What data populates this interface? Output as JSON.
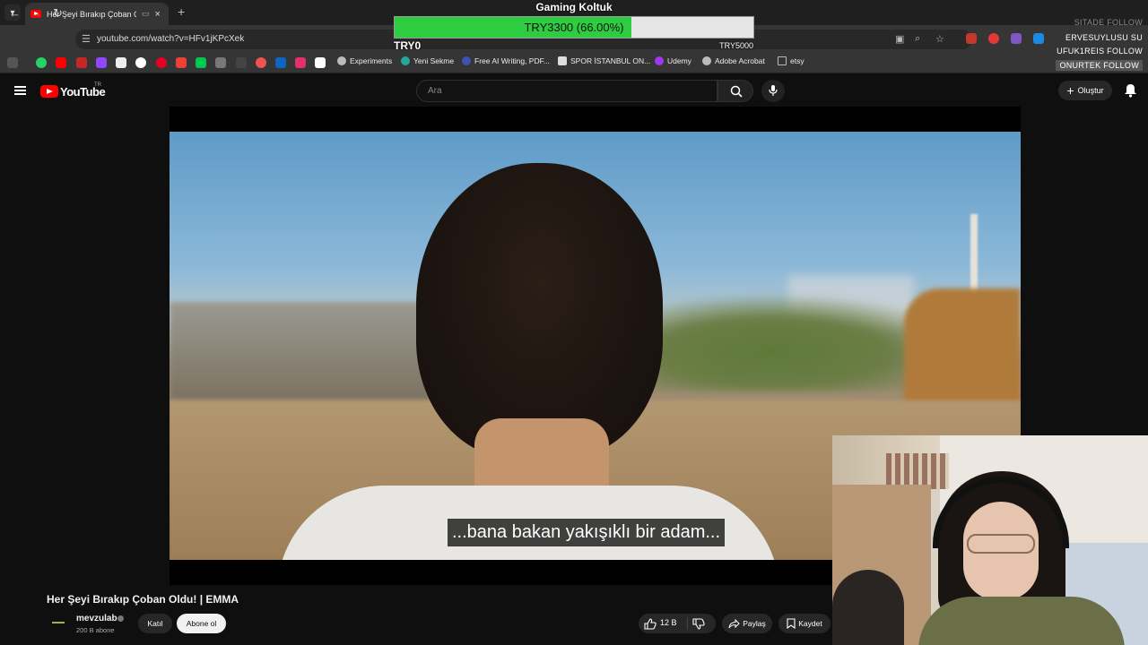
{
  "browser": {
    "tab_title": "Her Şeyi Bırakıp Çoban Oldu!",
    "url": "youtube.com/watch?v=HFv1jKPcXek",
    "bookmarks": [
      "Experiments",
      "Yeni Sekme",
      "Free AI Writing, PDF...",
      "SPOR İSTANBUL ON...",
      "Udemy",
      "Adobe Acrobat",
      "etsy"
    ]
  },
  "overlay": {
    "goal_title": "Gaming Koltuk",
    "goal_text": "TRY3300 (66.00%)",
    "goal_progress": 0.66,
    "goal_min": "TRY0",
    "goal_max": "TRY5000",
    "follows": [
      "SITADE  FOLLOW",
      "ERVESUYLUSU  SU",
      "UFUK1REIS  FOLLOW",
      "ONURTEK  FOLLOW"
    ]
  },
  "youtube": {
    "region": "TR",
    "search_placeholder": "Ara",
    "create_label": "Oluştur",
    "subtitle": "...bana bakan yakışıklı bir adam...",
    "video_title": "Her Şeyi Bırakıp Çoban Oldu! | EMMA",
    "channel_name": "mevzulab",
    "subscribers": "200 B abone",
    "join_label": "Katıl",
    "subscribe_label": "Abone ol",
    "like_count": "12 B",
    "share_label": "Paylaş",
    "save_label": "Kaydet"
  },
  "colors": {
    "brand": "#ff0000",
    "goal_fill": "#2ecc40",
    "background": "#0f0f0f"
  }
}
